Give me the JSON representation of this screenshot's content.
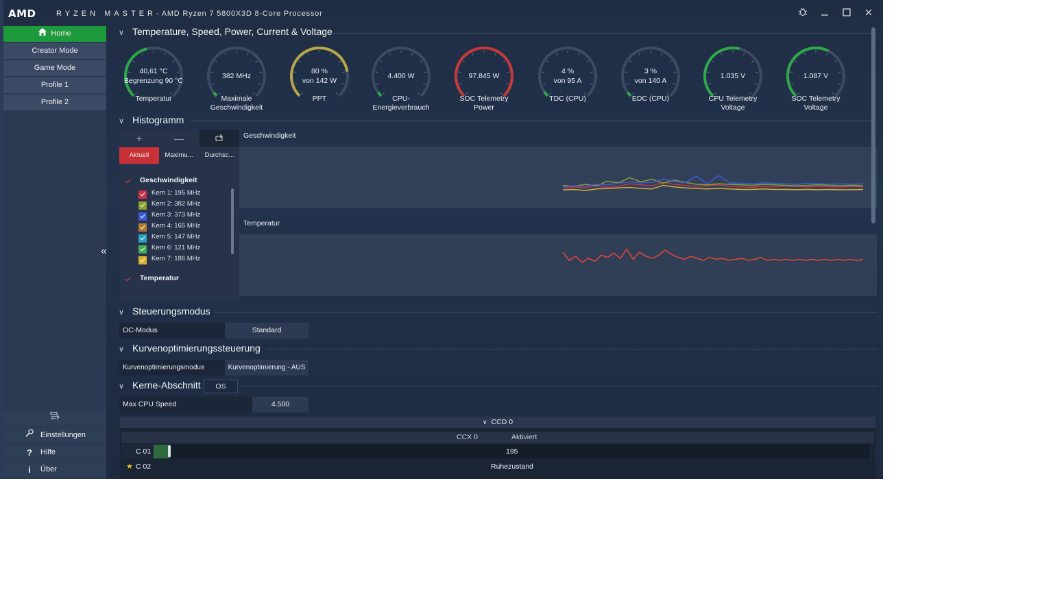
{
  "titlebar": {
    "logo": "AMD",
    "app_name": "RYZEN MASTER",
    "processor": "-  AMD Ryzen 7 5800X3D 8-Core Processor",
    "bug_icon": "bug-icon",
    "minimize_icon": "minimize-icon",
    "maximize_icon": "maximize-icon",
    "close_icon": "close-icon"
  },
  "sidebar": {
    "items": [
      {
        "label": "Home",
        "icon": "home-icon",
        "active": true
      },
      {
        "label": "Creator Mode"
      },
      {
        "label": "Game Mode"
      },
      {
        "label": "Profile 1"
      },
      {
        "label": "Profile 2"
      }
    ],
    "bottom": [
      {
        "label": "",
        "icon": "compare-icon"
      },
      {
        "label": "Einstellungen",
        "icon": "settings-icon"
      },
      {
        "label": "Hilfe",
        "icon": "help-icon"
      },
      {
        "label": "Über",
        "icon": "info-icon"
      }
    ],
    "accent": "#1e9a3c"
  },
  "sections": {
    "gauges_title": "Temperature, Speed, Power, Current & Voltage",
    "histogram_title": "Histogramm",
    "control_title": "Steuerungsmodus",
    "curve_title": "Kurvenoptimierungssteuerung",
    "cores_title": "Kerne-Abschnitt"
  },
  "gauges": [
    {
      "v1": "40,61 °C",
      "v2": "Begrenzung 90 °C",
      "label": "Temperatur",
      "level": 0.45,
      "color": "#2ea84a"
    },
    {
      "v1": "382  MHz",
      "v2": "",
      "label": "Maximale Geschwindigkeit",
      "level": 0.0,
      "color": "#2ea84a"
    },
    {
      "v1": "80 %",
      "v2": "von 142 W",
      "label": "PPT",
      "level": 0.8,
      "color": "#b9a84a"
    },
    {
      "v1": "4.400 W",
      "v2": "",
      "label": "CPU-Energieverbrauch",
      "level": 0.03,
      "color": "#2ea84a"
    },
    {
      "v1": "97.845 W",
      "v2": "",
      "label": "SOC Telemetry Power",
      "level": 1.0,
      "color": "#c83a3a"
    },
    {
      "v1": "4 %",
      "v2": "von 95 A",
      "label": "TDC (CPU)",
      "level": 0.04,
      "color": "#2ea84a"
    },
    {
      "v1": "3 %",
      "v2": "von 140 A",
      "label": "EDC (CPU)",
      "level": 0.03,
      "color": "#2ea84a"
    },
    {
      "v1": "1.035 V",
      "v2": "",
      "label": "CPU Telemetry Voltage",
      "level": 0.55,
      "color": "#2ea84a"
    },
    {
      "v1": "1.087 V",
      "v2": "",
      "label": "SOC Telemetry Voltage",
      "level": 0.6,
      "color": "#2ea84a"
    }
  ],
  "histogram": {
    "tabs": [
      "Aktuell",
      "Maximu...",
      "Durchsc..."
    ],
    "active_tab": "Aktuell",
    "add_icon": "plus-icon",
    "remove_icon": "minus-icon",
    "reset_icon": "reset-icon",
    "categories": [
      {
        "name": "Geschwindigkeit",
        "checked": true
      },
      {
        "name": "Temperatur",
        "checked": true
      }
    ],
    "cores": [
      {
        "label": "Kern 1: 195 MHz",
        "color": "#c8324a"
      },
      {
        "label": "Kern 2: 382 MHz",
        "color": "#8aa030"
      },
      {
        "label": "Kern 3: 373 MHz",
        "color": "#3b5bd8"
      },
      {
        "label": "Kern 4: 165 MHz",
        "color": "#b07a30"
      },
      {
        "label": "Kern 5: 147 MHz",
        "color": "#2aa0c0"
      },
      {
        "label": "Kern 6: 121 MHz",
        "color": "#3fae4e"
      },
      {
        "label": "Kern 7: 186 MHz",
        "color": "#d8b030"
      }
    ],
    "chart_speed_title": "Geschwindigkeit",
    "chart_temp_title": "Temperatur"
  },
  "controls": {
    "oc_label": "OC-Modus",
    "oc_value": "Standard",
    "curve_label": "Kurvenoptimierungsmodus",
    "curve_value": "Kurvenoptimierung - AUS",
    "os_button": "OS",
    "max_speed_label": "Max CPU Speed",
    "max_speed_value": "4.500"
  },
  "ccd": {
    "header": "CCD 0",
    "ccx": "CCX 0",
    "status": "Aktiviert",
    "cores": [
      {
        "name": "C 01",
        "value": "195",
        "star": false
      },
      {
        "name": "C 02",
        "value": "Ruhezustand",
        "star": true
      }
    ]
  },
  "chart_data": [
    {
      "type": "line",
      "title": "Geschwindigkeit",
      "series": [
        {
          "name": "Kern 1",
          "values": [
            120,
            150,
            130,
            180,
            140,
            160,
            210,
            190,
            170,
            240,
            200,
            180,
            160,
            170,
            190,
            160,
            150,
            140,
            160,
            150,
            170,
            160,
            150,
            160,
            150,
            150,
            160,
            150
          ]
        },
        {
          "name": "Kern 2",
          "values": [
            180,
            160,
            200,
            170,
            260,
            230,
            330,
            250,
            300,
            220,
            280,
            240,
            200,
            190,
            210,
            200,
            190,
            180,
            200,
            190,
            180,
            170,
            180,
            190,
            180,
            170,
            180,
            170
          ]
        },
        {
          "name": "Kern 3",
          "values": [
            150,
            170,
            160,
            200,
            190,
            220,
            250,
            230,
            240,
            300,
            260,
            230,
            360,
            210,
            370,
            230,
            220,
            210,
            230,
            220,
            210,
            200,
            220,
            210,
            200,
            210,
            200,
            210
          ]
        },
        {
          "name": "Kern 7",
          "values": [
            90,
            100,
            80,
            110,
            120,
            130,
            140,
            120,
            110,
            180,
            150,
            130,
            120,
            110,
            120,
            110,
            100,
            100,
            110,
            100,
            100,
            95,
            100,
            95,
            100,
            95,
            95,
            100
          ]
        }
      ]
    },
    {
      "type": "line",
      "title": "Temperatur",
      "series": [
        {
          "name": "Temperatur",
          "values": [
            41.6,
            40.8,
            41.2,
            40.6,
            41.0,
            40.7,
            41.3,
            41.1,
            41.5,
            41.0,
            41.9,
            40.9,
            41.6,
            41.2,
            41.0,
            41.3,
            41.8,
            41.4,
            41.1,
            40.9,
            41.2,
            41.0,
            40.8,
            41.1,
            40.9,
            41.0,
            40.8,
            40.9,
            41.0,
            40.8,
            40.9,
            41.1,
            40.8,
            40.9,
            40.8,
            40.9,
            40.8,
            40.9,
            40.8,
            40.9,
            40.8,
            40.9,
            40.8,
            40.9,
            40.8,
            40.9,
            40.8,
            40.9
          ]
        }
      ]
    }
  ]
}
